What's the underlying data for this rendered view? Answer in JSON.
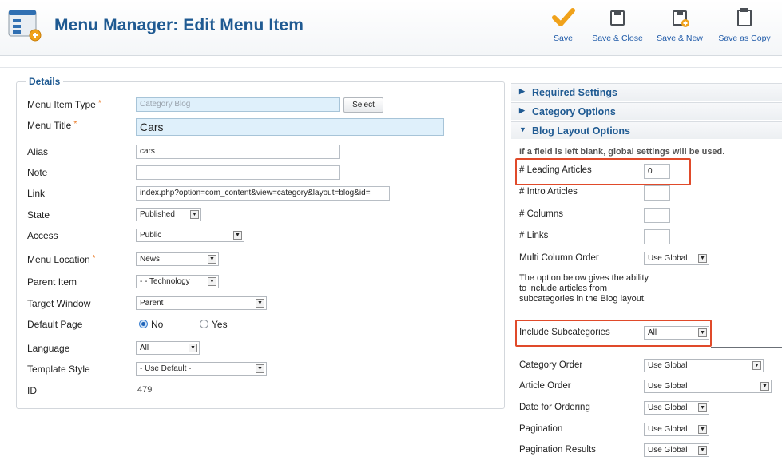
{
  "header": {
    "title": "Menu Manager: Edit Menu Item",
    "toolbar": [
      {
        "label": "Save",
        "icon": "check-icon"
      },
      {
        "label": "Save & Close",
        "icon": "save-close-icon"
      },
      {
        "label": "Save & New",
        "icon": "save-new-icon"
      },
      {
        "label": "Save as Copy",
        "icon": "save-copy-icon"
      }
    ]
  },
  "details": {
    "legend": "Details",
    "menu_item_type": {
      "label": "Menu Item Type",
      "value": "Category Blog",
      "button": "Select"
    },
    "menu_title": {
      "label": "Menu Title",
      "value": "Cars"
    },
    "alias": {
      "label": "Alias",
      "value": "cars"
    },
    "note": {
      "label": "Note",
      "value": ""
    },
    "link": {
      "label": "Link",
      "value": "index.php?option=com_content&view=category&layout=blog&id="
    },
    "state": {
      "label": "State",
      "value": "Published"
    },
    "access": {
      "label": "Access",
      "value": "Public"
    },
    "menu_location": {
      "label": "Menu Location",
      "value": "News"
    },
    "parent_item": {
      "label": "Parent Item",
      "value": "- - Technology"
    },
    "target_window": {
      "label": "Target Window",
      "value": "Parent"
    },
    "default_page": {
      "label": "Default Page",
      "options": [
        "No",
        "Yes"
      ],
      "selected": "No"
    },
    "language": {
      "label": "Language",
      "value": "All"
    },
    "template_style": {
      "label": "Template Style",
      "value": "- Use Default -"
    },
    "id": {
      "label": "ID",
      "value": "479"
    },
    "required_marker": "*"
  },
  "panel": {
    "required_settings": "Required Settings",
    "category_options": "Category Options",
    "blog_layout_options": "Blog Layout Options",
    "hint": "If a field is left blank, global settings will be used.",
    "leading_articles": {
      "label": "# Leading Articles",
      "value": "0"
    },
    "intro_articles": {
      "label": "# Intro Articles",
      "value": ""
    },
    "columns": {
      "label": "# Columns",
      "value": ""
    },
    "links": {
      "label": "# Links",
      "value": ""
    },
    "multi_column_order": {
      "label": "Multi Column Order",
      "value": "Use Global"
    },
    "subcategories_note": "The option below gives the ability to include articles from subcategories in the Blog layout.",
    "include_subcategories": {
      "label": "Include Subcategories",
      "value": "All"
    },
    "category_order": {
      "label": "Category Order",
      "value": "Use Global"
    },
    "article_order": {
      "label": "Article Order",
      "value": "Use Global"
    },
    "date_for_ordering": {
      "label": "Date for Ordering",
      "value": "Use Global"
    },
    "pagination": {
      "label": "Pagination",
      "value": "Use Global"
    },
    "pagination_results": {
      "label": "Pagination Results",
      "value": "Use Global"
    }
  },
  "colors": {
    "title": "#1f5a92",
    "link": "#1e5aa8",
    "highlight": "#e04a2a",
    "save_check": "#f0a21b",
    "required": "#e8731a"
  }
}
